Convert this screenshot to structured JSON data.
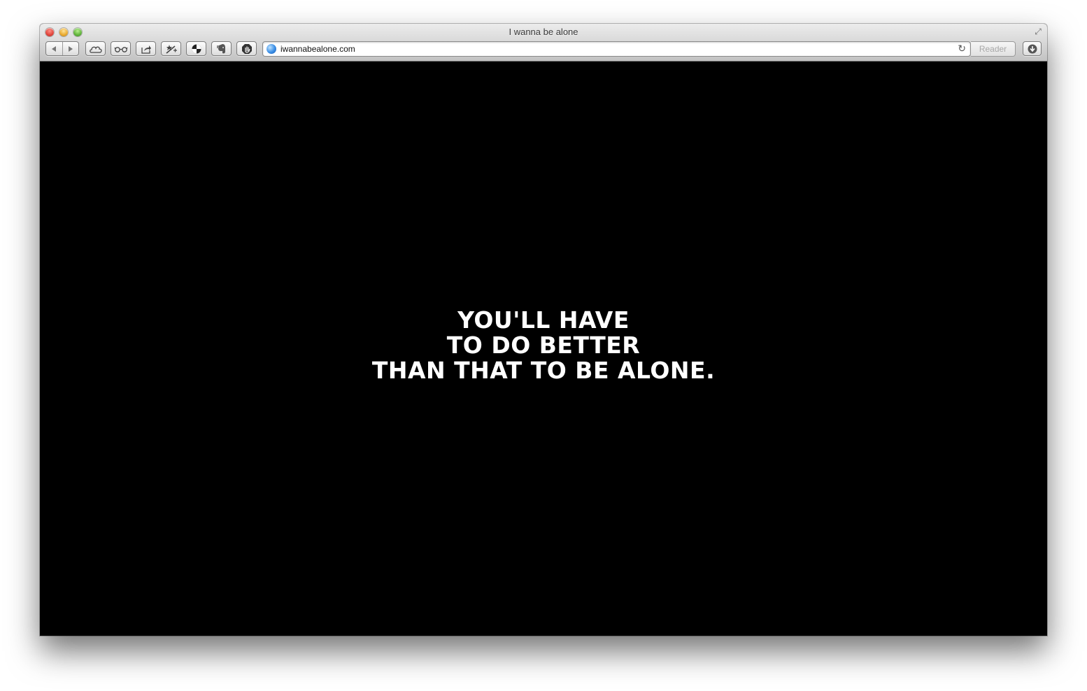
{
  "window": {
    "title": "I wanna be alone"
  },
  "toolbar": {
    "back_icon": "back-arrow-icon",
    "forward_icon": "forward-arrow-icon",
    "buttons": [
      "icloud-icon",
      "reading-list-glasses-icon",
      "share-icon",
      "bookmark-star-icon",
      "extension-pie-icon",
      "evernote-elephant-icon",
      "adblock-hand-icon"
    ],
    "address": {
      "url": "iwannabealone.com"
    },
    "reader_label": "Reader",
    "download_icon": "download-icon"
  },
  "page": {
    "lines": [
      "YOU'LL HAVE",
      "TO DO BETTER",
      "THAN THAT TO BE ALONE."
    ]
  },
  "colors": {
    "page_background": "#000000",
    "text": "#ffffff"
  }
}
